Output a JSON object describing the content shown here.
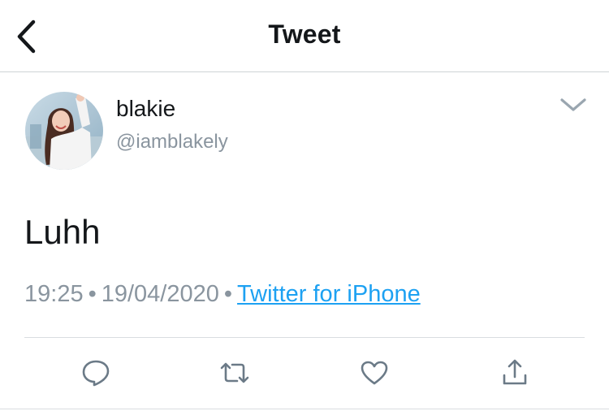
{
  "header": {
    "title": "Tweet",
    "back_icon": "chevron-left-icon"
  },
  "tweet": {
    "author": {
      "display_name": "blakie",
      "handle": "@iamblakely"
    },
    "text": "Luhh",
    "time": "19:25",
    "date": "19/04/2020",
    "separator": "•",
    "source": "Twitter for iPhone"
  },
  "actions": [
    {
      "name": "reply",
      "icon": "reply-icon"
    },
    {
      "name": "retweet",
      "icon": "retweet-icon"
    },
    {
      "name": "like",
      "icon": "heart-icon"
    },
    {
      "name": "share",
      "icon": "share-icon"
    }
  ],
  "colors": {
    "link": "#1da1f2",
    "secondary_text": "#8a959f",
    "icon": "#6b7a87",
    "divider": "#d9dde0"
  }
}
